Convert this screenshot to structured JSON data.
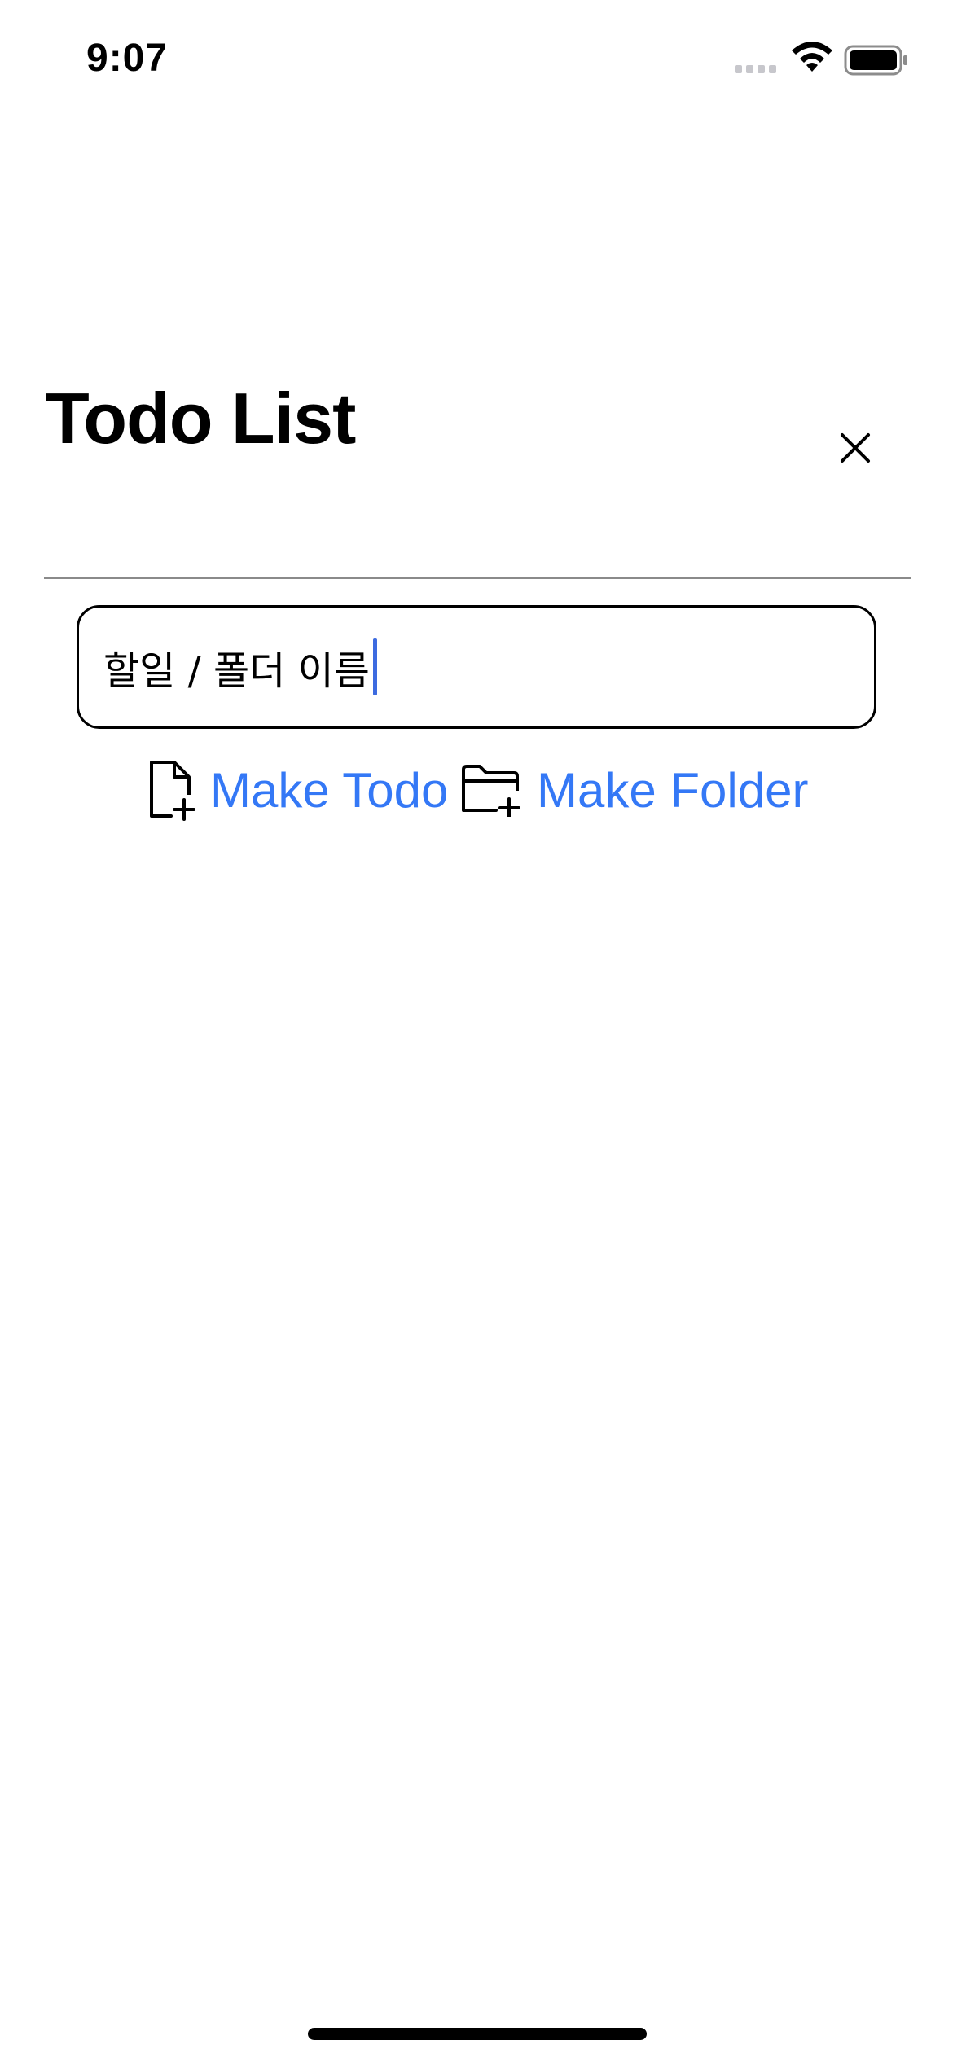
{
  "status_bar": {
    "time": "9:07"
  },
  "header": {
    "title": "Todo List",
    "close_icon": "close-icon"
  },
  "input": {
    "value": "할일 / 폴더 이름",
    "placeholder": "할일 / 폴더 이름"
  },
  "actions": {
    "make_todo_label": "Make Todo",
    "make_todo_icon": "doc-plus-icon",
    "make_folder_label": "Make Folder",
    "make_folder_icon": "folder-plus-icon"
  },
  "colors": {
    "accent": "#3478f6",
    "caret": "#3d6be0",
    "divider": "#8a8a8a"
  }
}
